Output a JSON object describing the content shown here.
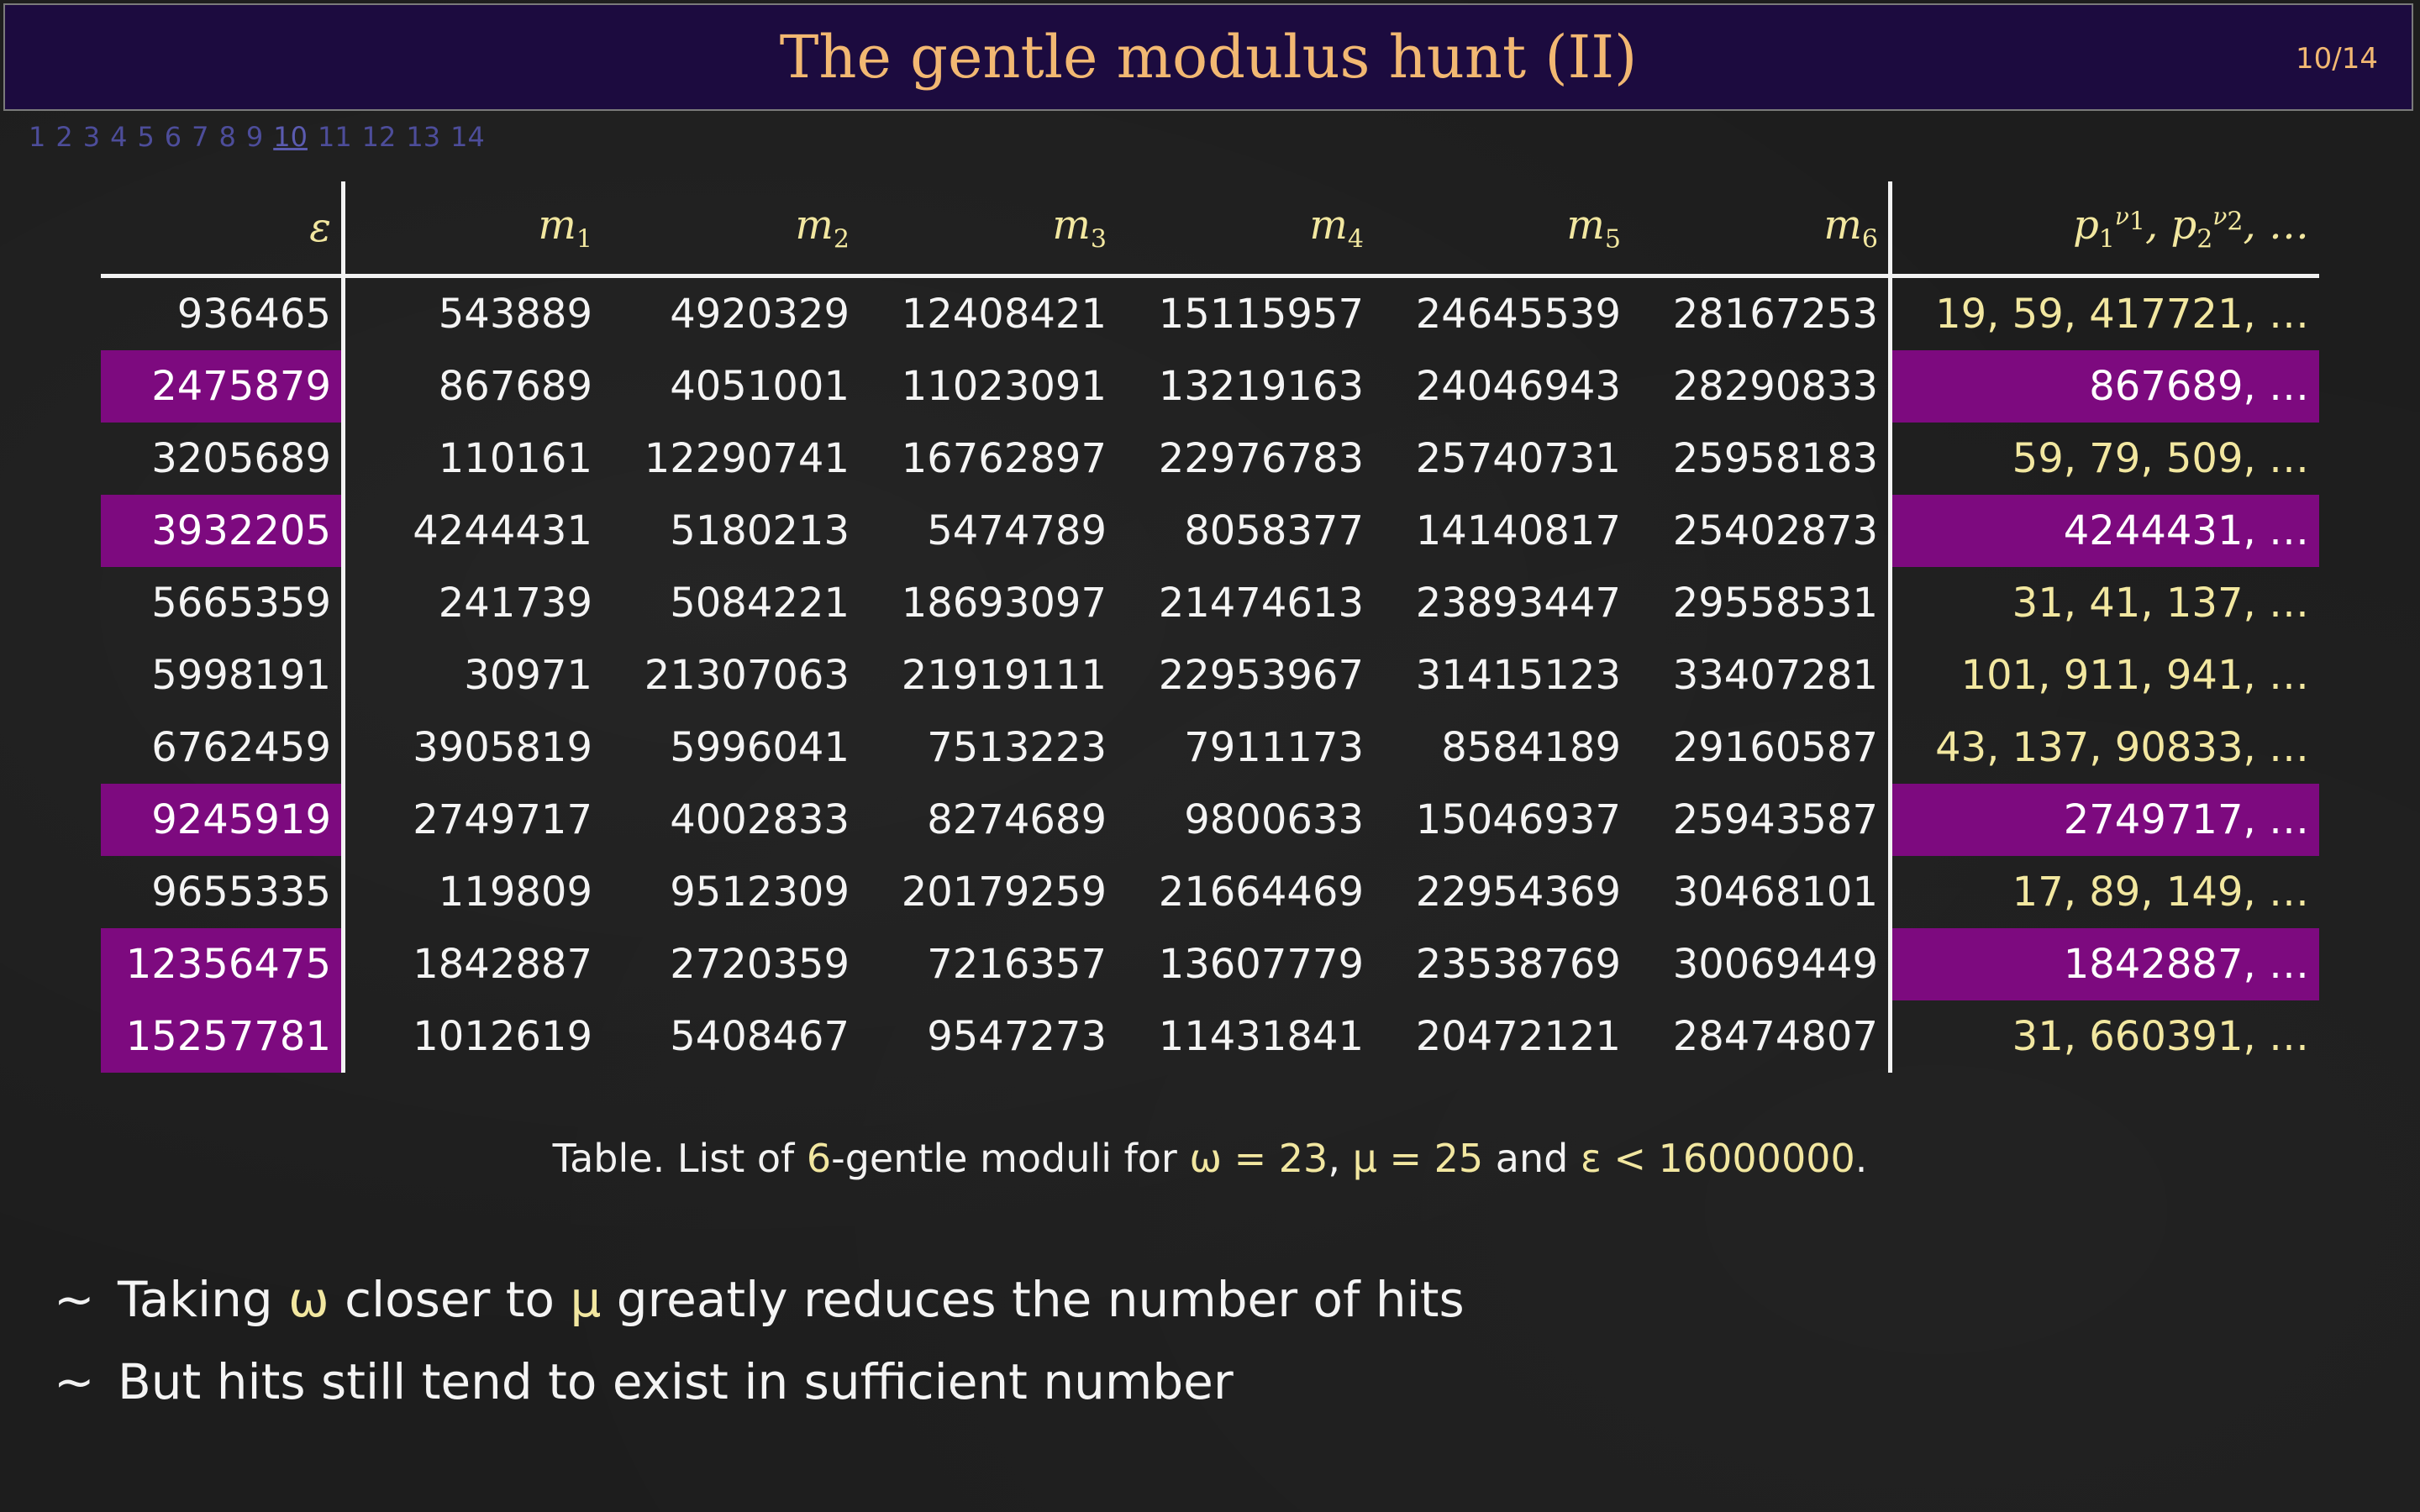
{
  "slide": {
    "title": "The gentle modulus hunt (II)",
    "page_indicator": "10/14",
    "nav": [
      "1",
      "2",
      "3",
      "4",
      "5",
      "6",
      "7",
      "8",
      "9",
      "10",
      "11",
      "12",
      "13",
      "14"
    ],
    "nav_current": "10"
  },
  "table": {
    "headers": {
      "eps": "ε",
      "m": [
        {
          "base": "m",
          "sub": "1"
        },
        {
          "base": "m",
          "sub": "2"
        },
        {
          "base": "m",
          "sub": "3"
        },
        {
          "base": "m",
          "sub": "4"
        },
        {
          "base": "m",
          "sub": "5"
        },
        {
          "base": "m",
          "sub": "6"
        }
      ],
      "primes": {
        "p1": "p",
        "s1": "1",
        "v1": "ν",
        "vs1": "1",
        "p2": "p",
        "s2": "2",
        "v2": "ν",
        "vs2": "2",
        "tail": ", …"
      }
    },
    "rows": [
      {
        "eps": "936465",
        "m": [
          "543889",
          "4920329",
          "12408421",
          "15115957",
          "24645539",
          "28167253"
        ],
        "primes": "19, 59, 417721, …",
        "highlight": false
      },
      {
        "eps": "2475879",
        "m": [
          "867689",
          "4051001",
          "11023091",
          "13219163",
          "24046943",
          "28290833"
        ],
        "primes": "867689, …",
        "highlight": true
      },
      {
        "eps": "3205689",
        "m": [
          "110161",
          "12290741",
          "16762897",
          "22976783",
          "25740731",
          "25958183"
        ],
        "primes": "59, 79, 509, …",
        "highlight": false
      },
      {
        "eps": "3932205",
        "m": [
          "4244431",
          "5180213",
          "5474789",
          "8058377",
          "14140817",
          "25402873"
        ],
        "primes": "4244431, …",
        "highlight": true
      },
      {
        "eps": "5665359",
        "m": [
          "241739",
          "5084221",
          "18693097",
          "21474613",
          "23893447",
          "29558531"
        ],
        "primes": "31, 41, 137, …",
        "highlight": false
      },
      {
        "eps": "5998191",
        "m": [
          "30971",
          "21307063",
          "21919111",
          "22953967",
          "31415123",
          "33407281"
        ],
        "primes": "101, 911, 941, …",
        "highlight": false
      },
      {
        "eps": "6762459",
        "m": [
          "3905819",
          "5996041",
          "7513223",
          "7911173",
          "8584189",
          "29160587"
        ],
        "primes": "43, 137, 90833, …",
        "highlight": false
      },
      {
        "eps": "9245919",
        "m": [
          "2749717",
          "4002833",
          "8274689",
          "9800633",
          "15046937",
          "25943587"
        ],
        "primes": "2749717, …",
        "highlight": true
      },
      {
        "eps": "9655335",
        "m": [
          "119809",
          "9512309",
          "20179259",
          "21664469",
          "22954369",
          "30468101"
        ],
        "primes": "17, 89, 149, …",
        "highlight": false
      },
      {
        "eps": "12356475",
        "m": [
          "1842887",
          "2720359",
          "7216357",
          "13607779",
          "23538769",
          "30069449"
        ],
        "primes": "1842887, …",
        "highlight": true
      },
      {
        "eps": "15257781",
        "m": [
          "1012619",
          "5408467",
          "9547273",
          "11431841",
          "20472121",
          "28474807"
        ],
        "primes": "31, 660391, …",
        "highlight": "eps"
      }
    ]
  },
  "caption": {
    "prefix": "Table.  List of ",
    "n": "6",
    "mid1": "-gentle moduli for ",
    "omega": "ω = 23",
    "comma": ", ",
    "mu": "μ = 25",
    "and": " and ",
    "eps": "ε < 16000000",
    "end": "."
  },
  "bullets": [
    {
      "tilde": "~",
      "a": "Taking ",
      "b": "ω",
      "c": " closer to ",
      "d": "μ",
      "e": " greatly reduces the number of hits"
    },
    {
      "tilde": "~",
      "a": "But hits still tend to exist in sufficient number",
      "b": "",
      "c": "",
      "d": "",
      "e": ""
    }
  ],
  "colors": {
    "highlight": "#7d0a7f",
    "title": "#f2b872",
    "titlebar": "#1c0b3f",
    "accent": "#f2e7a0"
  }
}
